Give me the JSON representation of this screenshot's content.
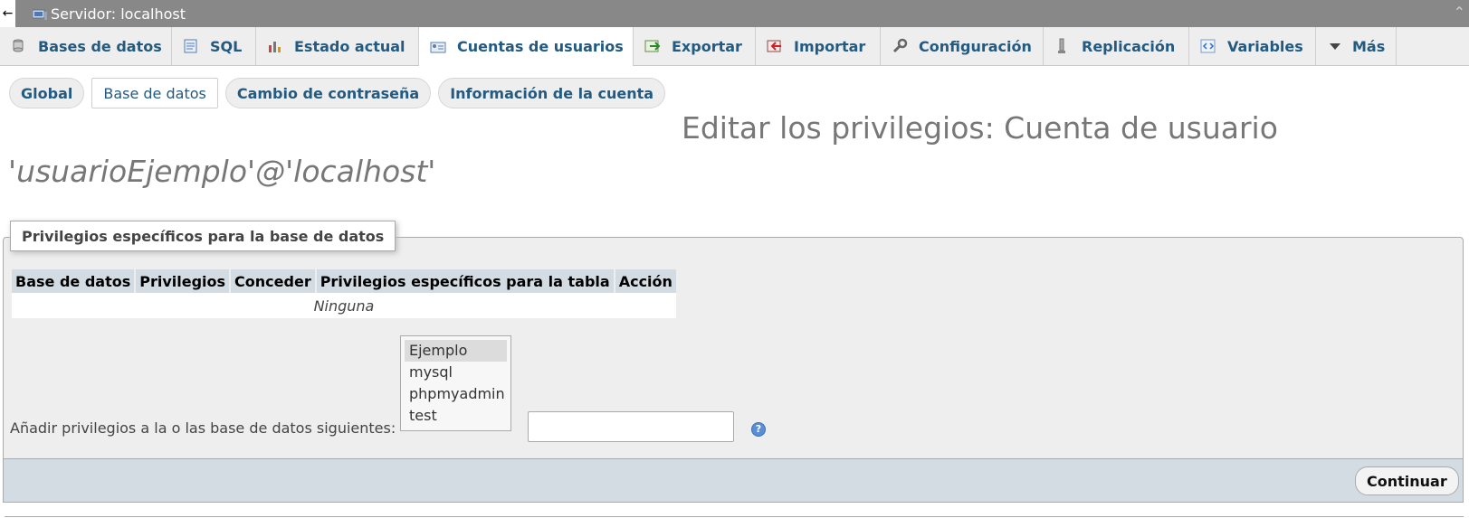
{
  "serverbar": {
    "back_icon": "back-arrow-icon",
    "server_icon": "server-icon",
    "title": "Servidor: localhost",
    "collapse_icon": "collapse-up-icon"
  },
  "main_tabs": [
    {
      "label": "Bases de datos",
      "icon": "database-icon"
    },
    {
      "label": "SQL",
      "icon": "sql-icon"
    },
    {
      "label": "Estado actual",
      "icon": "status-icon"
    },
    {
      "label": "Cuentas de usuarios",
      "icon": "user-accounts-icon",
      "active": true
    },
    {
      "label": "Exportar",
      "icon": "export-icon"
    },
    {
      "label": "Importar",
      "icon": "import-icon"
    },
    {
      "label": "Configuración",
      "icon": "wrench-icon"
    },
    {
      "label": "Replicación",
      "icon": "replication-icon"
    },
    {
      "label": "Variables",
      "icon": "variables-icon"
    },
    {
      "label": "Más",
      "icon": "triangle-down-icon"
    }
  ],
  "sub_tabs": [
    {
      "label": "Global"
    },
    {
      "label": "Base de datos",
      "active": true
    },
    {
      "label": "Cambio de contraseña"
    },
    {
      "label": "Información de la cuenta"
    }
  ],
  "heading": {
    "line1": "Editar los privilegios: Cuenta de usuario",
    "line2": "'usuarioEjemplo'@'localhost'"
  },
  "fieldset": {
    "legend": "Privilegios específicos para la base de datos",
    "columns": [
      "Base de datos",
      "Privilegios",
      "Conceder",
      "Privilegios específicos para la tabla",
      "Acción"
    ],
    "empty_text": "Ninguna",
    "add_label": "Añadir privilegios a la o las base de datos siguientes:",
    "databases": [
      "Ejemplo",
      "mysql",
      "phpmyadmin",
      "test"
    ],
    "selected_database": "Ejemplo",
    "input_value": "",
    "help_icon": "help-icon"
  },
  "footer": {
    "continue_label": "Continuar"
  },
  "colors": {
    "tab_text": "#235a81",
    "tab_bg": "#eeeeee",
    "header_bar": "#888888",
    "table_header": "#d3dce3"
  }
}
